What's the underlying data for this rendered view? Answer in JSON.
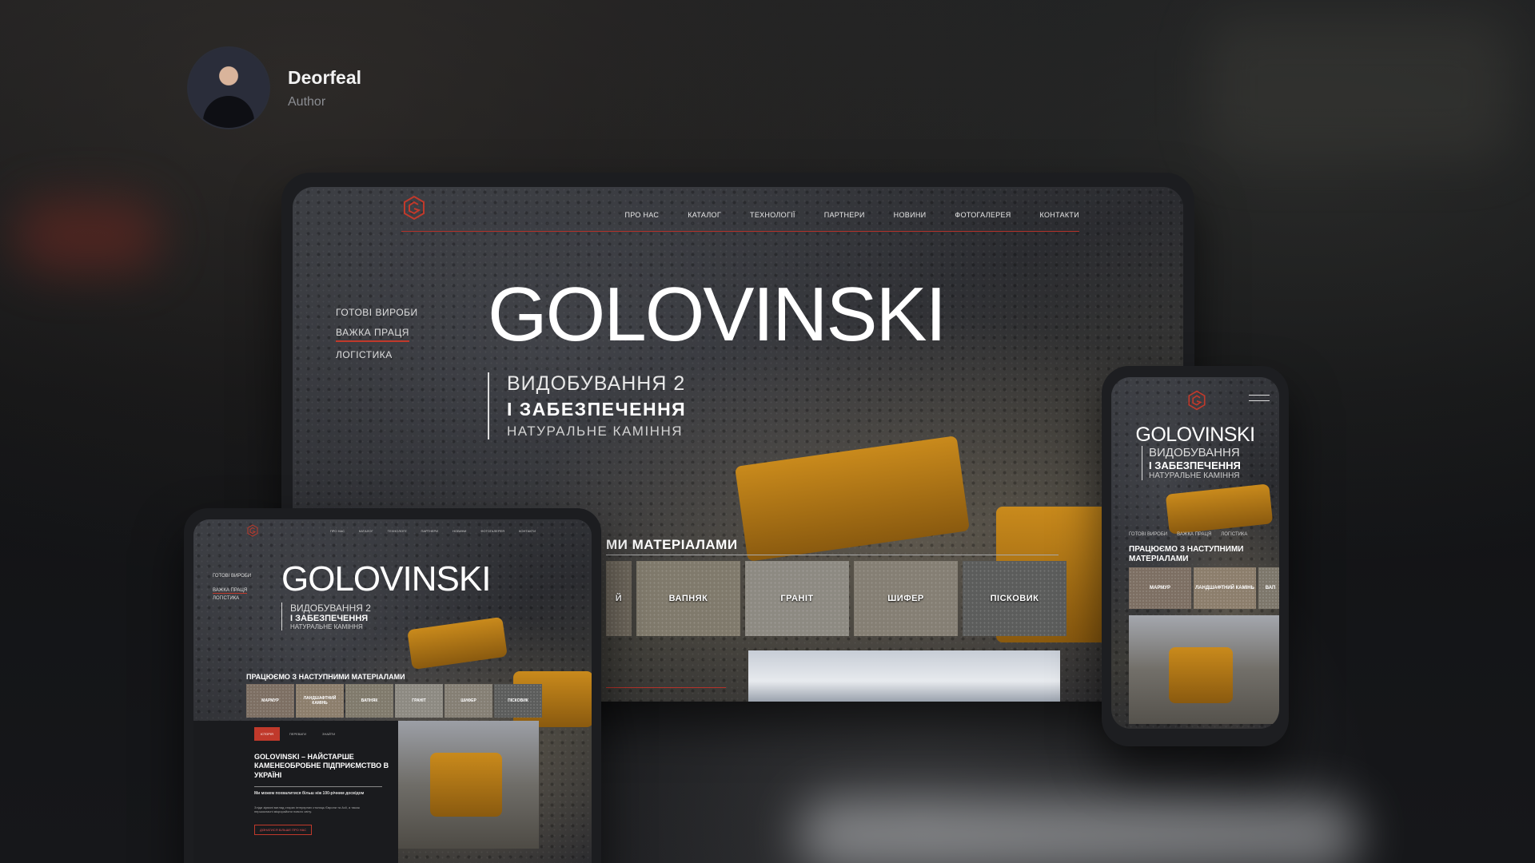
{
  "author": {
    "name": "Deorfeal",
    "role": "Author"
  },
  "desktop": {
    "nav": [
      "ПРО НАС",
      "КАТАЛОГ",
      "ТЕХНОЛОГІЇ",
      "ПАРТНЕРИ",
      "НОВИНИ",
      "ФОТОГАЛЕРЕЯ",
      "КОНТАКТИ"
    ],
    "side_menu": [
      "ГОТОВІ ВИРОБИ",
      "ВАЖКА ПРАЦЯ",
      "ЛОГІСТИКА"
    ],
    "title": "GOLOVINSKI",
    "sub1": "ВИДОБУВАННЯ 2",
    "sub2": "І ЗАБЕЗПЕЧЕННЯ",
    "sub3": "НАТУРАЛЬНЕ КАМІННЯ",
    "materials_head": "МИ МАТЕРІАЛАМИ",
    "tiles": [
      "Й",
      "ВАПНЯК",
      "ГРАНІТ",
      "ШИФЕР",
      "ПІСКОВИК"
    ]
  },
  "tablet": {
    "nav": [
      "ПРО НАС",
      "КАТАЛОГ",
      "ТЕХНОЛОГІЇ",
      "ПАРТНЕРИ",
      "НОВИНИ",
      "ФОТОГАЛЕРЕЯ",
      "КОНТАКТИ"
    ],
    "side_menu": [
      "ГОТОВІ ВИРОБИ",
      "ВАЖКА ПРАЦЯ",
      "ЛОГІСТИКА"
    ],
    "title": "GOLOVINSKI",
    "sub1": "ВИДОБУВАННЯ 2",
    "sub2": "І ЗАБЕЗПЕЧЕННЯ",
    "sub3": "НАТУРАЛЬНЕ КАМІННЯ",
    "materials_head": "ПРАЦЮЄМО З НАСТУПНИМИ МАТЕРІАЛАМИ",
    "tiles": [
      "МАРМУР",
      "ЛАНДШАФТНИЙ КАМІНЬ",
      "ВАПНЯК",
      "ГРАНІТ",
      "ШИФЕР",
      "ПІСКОВИК"
    ],
    "tabs": [
      "ІСТОРІЯ",
      "ПЕРЕВАГИ",
      "ЗНАЙТИ"
    ],
    "about": "GOLOVINSKI – НАЙСТАРШЕ КАМЕНЕОБРОБНЕ ПІДПРИЄМСТВО В УКРАЇНІ",
    "small1": "Ми можем похвалитися більш ніж 100-річним досвідом",
    "small2": "Зліди зірвані вигляд старих інтерєрних столиць Європи та Азії, а також першокласні мікрорайони нового світу.",
    "btn": "ДІЗНАТИСЯ БІЛЬШЕ ПРО НАС"
  },
  "phone": {
    "title": "GOLOVINSKI",
    "sub1": "ВИДОБУВАННЯ",
    "sub2": "І ЗАБЕЗПЕЧЕННЯ",
    "sub3": "НАТУРАЛЬНЕ КАМІННЯ",
    "menu": [
      "ГОТОВІ ВИРОБИ",
      "ВАЖКА ПРАЦЯ",
      "ЛОГІСТИКА"
    ],
    "materials_head": "ПРАЦЮЄМО З НАСТУПНИМИ МАТЕРІАЛАМИ",
    "tiles": [
      "МАРМУР",
      "ЛАНДШАФТНИЙ КАМІНЬ",
      "ВАП"
    ]
  },
  "colors": {
    "accent": "#c0392b",
    "background": "#111214"
  }
}
